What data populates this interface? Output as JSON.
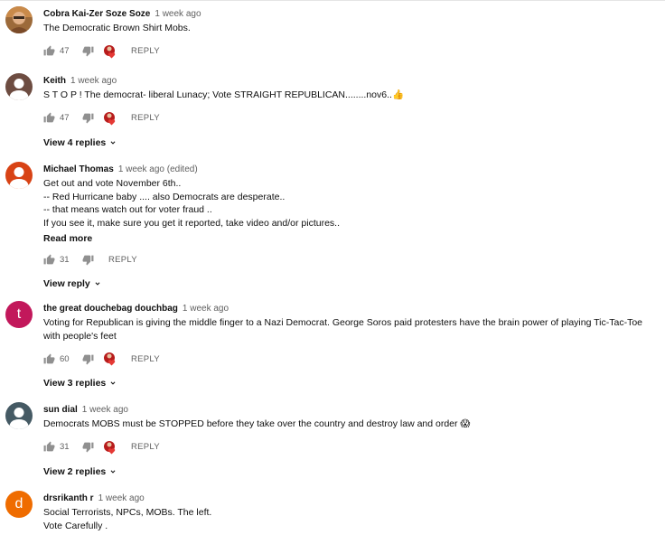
{
  "comments": [
    {
      "author": "Cobra Kai-Zer Soze Soze",
      "time": "1 week ago",
      "text": "The Democratic Brown Shirt Mobs.",
      "likes": "47",
      "reply_label": "REPLY",
      "avatar": "photo"
    },
    {
      "author": "Keith",
      "time": "1 week ago",
      "text": "S T O P ! The democrat- liberal Lunacy; Vote STRAIGHT REPUBLICAN........nov6..👍",
      "likes": "47",
      "reply_label": "REPLY",
      "view_replies": "View 4 replies",
      "avatar": "default-brown"
    },
    {
      "author": "Michael Thomas",
      "time": "1 week ago (edited)",
      "text": "Get out and vote November 6th..\n-- Red Hurricane baby .... also Democrats are desperate..\n-- that means watch out for voter fraud ..\nIf you see it, make sure you get it reported, take video and/or pictures..",
      "read_more": "Read more",
      "likes": "31",
      "reply_label": "REPLY",
      "view_replies": "View reply",
      "avatar": "default-orange"
    },
    {
      "author": "the great douchebag douchbag",
      "time": "1 week ago",
      "text": "Voting for Republican is giving the middle finger to a Nazi Democrat. George Soros paid protesters have the brain power of playing Tic-Tac-Toe\nwith people's feet",
      "likes": "60",
      "reply_label": "REPLY",
      "view_replies": "View 3 replies",
      "avatar": "t"
    },
    {
      "author": "sun dial",
      "time": "1 week ago",
      "text": "Democrats MOBS must be STOPPED before they take over the country and destroy law and order 😱",
      "likes": "31",
      "reply_label": "REPLY",
      "view_replies": "View 2 replies",
      "avatar": "default-slate"
    },
    {
      "author": "drsrikanth r",
      "time": "1 week ago",
      "text": "Social Terrorists, NPCs, MOBs.    The left.\nVote Carefully .",
      "avatar": "d"
    }
  ],
  "colors": {
    "text": "#0f0f0f",
    "secondary": "#606060",
    "avatar_brown": "#6d4c41",
    "avatar_orange": "#d84315",
    "avatar_t": "#c2185b",
    "avatar_slate": "#455a64",
    "avatar_d": "#ef6c00",
    "heart": "#e53935"
  },
  "icons": {
    "like": "thumb-up-icon",
    "dislike": "thumb-down-icon",
    "creator_heart": "creator-heart-icon",
    "expand": "chevron-down-icon"
  }
}
